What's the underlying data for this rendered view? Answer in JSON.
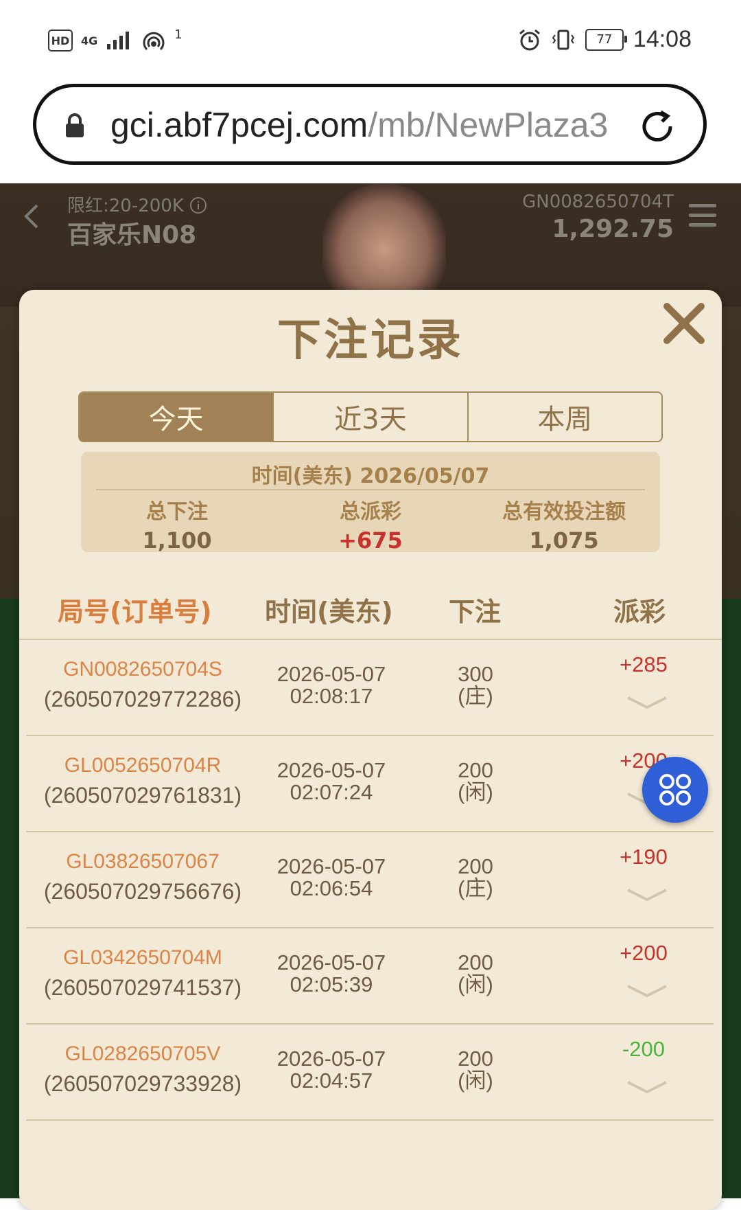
{
  "status_bar": {
    "hd": "HD",
    "network": "4G",
    "hotspot_count": "1",
    "battery": "77",
    "time": "14:08"
  },
  "browser": {
    "url_host": "gci.abf7pcej.com",
    "url_path": "/mb/NewPlaza3"
  },
  "game_header": {
    "limit": "限红:20-200K",
    "room": "百家乐N08",
    "round_id": "GN0082650704T",
    "balance": "1,292.75"
  },
  "modal": {
    "title": "下注记录",
    "tabs": [
      {
        "label": "今天",
        "active": true
      },
      {
        "label": "近3天",
        "active": false
      },
      {
        "label": "本周",
        "active": false
      }
    ],
    "summary": {
      "date": "时间(美东) 2026/05/07",
      "total_bet_label": "总下注",
      "total_bet": "1,100",
      "total_payout_label": "总派彩",
      "total_payout": "+675",
      "valid_bet_label": "总有效投注额",
      "valid_bet": "1,075"
    },
    "columns": [
      "局号(订单号)",
      "时间(美东)",
      "下注",
      "派彩"
    ],
    "rows": [
      {
        "round": "GN0082650704S",
        "order": "(260507029772286)",
        "date": "2026-05-07",
        "time": "02:08:17",
        "bet": "300",
        "side": "(庄)",
        "payout": "+285"
      },
      {
        "round": "GL0052650704R",
        "order": "(260507029761831)",
        "date": "2026-05-07",
        "time": "02:07:24",
        "bet": "200",
        "side": "(闲)",
        "payout": "+200"
      },
      {
        "round": "GL03826507067",
        "order": "(260507029756676)",
        "date": "2026-05-07",
        "time": "02:06:54",
        "bet": "200",
        "side": "(庄)",
        "payout": "+190"
      },
      {
        "round": "GL0342650704M",
        "order": "(260507029741537)",
        "date": "2026-05-07",
        "time": "02:05:39",
        "bet": "200",
        "side": "(闲)",
        "payout": "+200"
      },
      {
        "round": "GL0282650705V",
        "order": "(260507029733928)",
        "date": "2026-05-07",
        "time": "02:04:57",
        "bet": "200",
        "side": "(闲)",
        "payout": "-200"
      }
    ]
  },
  "colors": {
    "accent": "#a08256",
    "payout_positive": "#c8322c",
    "payout_negative": "#4cb23f",
    "float_button": "#2f5fd6"
  },
  "icons": [
    "lock-icon",
    "reload-icon",
    "back-icon",
    "info-icon",
    "menu-icon",
    "close-icon",
    "chevron-down-icon",
    "grid-menu-icon",
    "alarm-icon",
    "vibrate-icon",
    "hotspot-icon"
  ]
}
